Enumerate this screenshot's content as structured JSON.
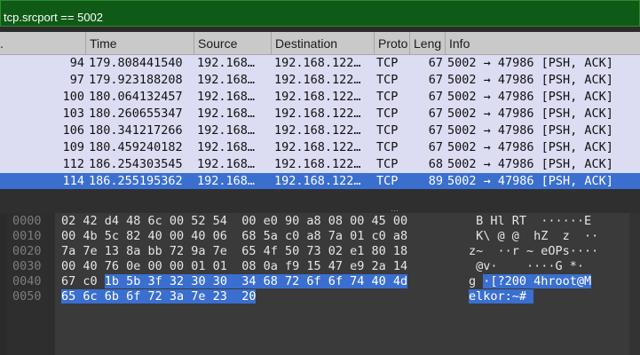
{
  "filter": {
    "value": "tcp.srcport == 5002"
  },
  "columns": {
    "no": ".",
    "time": "Time",
    "source": "Source",
    "destination": "Destination",
    "protocol": "Proto",
    "length": "Leng",
    "info": "Info"
  },
  "packets": [
    {
      "no": "94",
      "time": "179.808441540",
      "source": "192.168…",
      "destination": "192.168.122…",
      "protocol": "TCP",
      "length": "67",
      "info": "5002 → 47986 [PSH, ACK]"
    },
    {
      "no": "97",
      "time": "179.923188208",
      "source": "192.168…",
      "destination": "192.168.122…",
      "protocol": "TCP",
      "length": "67",
      "info": "5002 → 47986 [PSH, ACK]"
    },
    {
      "no": "100",
      "time": "180.064132457",
      "source": "192.168…",
      "destination": "192.168.122…",
      "protocol": "TCP",
      "length": "67",
      "info": "5002 → 47986 [PSH, ACK]"
    },
    {
      "no": "103",
      "time": "180.260655347",
      "source": "192.168…",
      "destination": "192.168.122…",
      "protocol": "TCP",
      "length": "67",
      "info": "5002 → 47986 [PSH, ACK]"
    },
    {
      "no": "106",
      "time": "180.341217266",
      "source": "192.168…",
      "destination": "192.168.122…",
      "protocol": "TCP",
      "length": "67",
      "info": "5002 → 47986 [PSH, ACK]"
    },
    {
      "no": "109",
      "time": "180.459240182",
      "source": "192.168…",
      "destination": "192.168.122…",
      "protocol": "TCP",
      "length": "67",
      "info": "5002 → 47986 [PSH, ACK]"
    },
    {
      "no": "112",
      "time": "186.254303545",
      "source": "192.168…",
      "destination": "192.168.122…",
      "protocol": "TCP",
      "length": "68",
      "info": "5002 → 47986 [PSH, ACK]"
    },
    {
      "no": "114",
      "time": "186.255195362",
      "source": "192.168…",
      "destination": "192.168.122…",
      "protocol": "TCP",
      "length": "89",
      "info": "5002 → 47986 [PSH, ACK]",
      "selected": true
    }
  ],
  "bytes": [
    {
      "offset": "0000",
      "hex": "02 42 d4 48 6c 00 52 54  00 e0 90 a8 08 00 45 00",
      "hex_hl": "",
      "ascii": " B Hl RT  ······E ",
      "ascii_hl": ""
    },
    {
      "offset": "0010",
      "hex": "00 4b 5c 82 40 00 40 06  68 5a c0 a8 7a 01 c0 a8",
      "hex_hl": "",
      "ascii": " K\\ @ @  hZ  z  ··",
      "ascii_hl": ""
    },
    {
      "offset": "0020",
      "hex": "7a 7e 13 8a bb 72 9a 7e  65 4f 50 73 02 e1 80 18",
      "hex_hl": "",
      "ascii": "z~  ··r ~ eOPs····",
      "ascii_hl": ""
    },
    {
      "offset": "0030",
      "hex": "00 40 76 0e 00 00 01 01  08 0a f9 15 47 e9 2a 14",
      "hex_hl": "",
      "ascii": " @v·    ····G *·",
      "ascii_hl": ""
    },
    {
      "offset": "0040",
      "hex": "67 c0 ",
      "hex_hl": "1b 5b 3f 32 30 30  34 68 72 6f 6f 74 40 4d",
      "ascii": "g ",
      "ascii_hl": "·[?200 4hroot@M"
    },
    {
      "offset": "0050",
      "hex": "",
      "hex_hl": "65 6c 6b 6f 72 3a 7e 23  20",
      "ascii": "",
      "ascii_hl": "elkor:~# "
    }
  ]
}
